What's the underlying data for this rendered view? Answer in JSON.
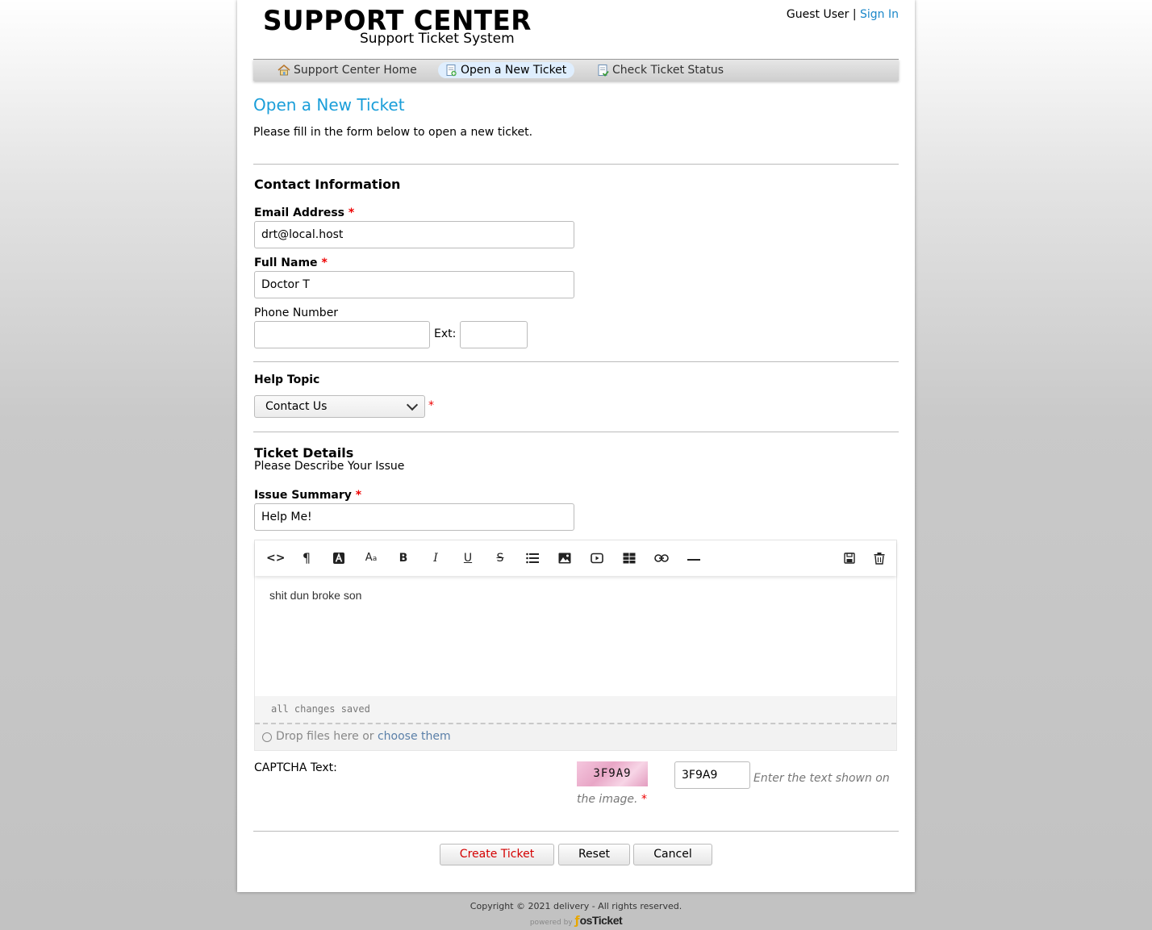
{
  "header": {
    "title": "SUPPORT CENTER",
    "subtitle": "Support Ticket System",
    "guest_label": "Guest User",
    "separator": "|",
    "sign_in": "Sign In"
  },
  "nav": {
    "items": [
      {
        "label": "Support Center Home",
        "icon": "home-icon"
      },
      {
        "label": "Open a New Ticket",
        "icon": "new-ticket-icon"
      },
      {
        "label": "Check Ticket Status",
        "icon": "ticket-status-icon"
      }
    ],
    "active": "Open a New Ticket"
  },
  "page": {
    "title": "Open a New Ticket",
    "intro": "Please fill in the form below to open a new ticket."
  },
  "contact": {
    "section_title": "Contact Information",
    "email_label": "Email Address",
    "email_value": "drt@local.host",
    "name_label": "Full Name",
    "name_value": "Doctor T",
    "phone_label": "Phone Number",
    "phone_value": "",
    "ext_label": "Ext:",
    "ext_value": ""
  },
  "help_topic": {
    "label": "Help Topic",
    "selected": "Contact Us"
  },
  "ticket": {
    "section_title": "Ticket Details",
    "section_sub": "Please Describe Your Issue",
    "summary_label": "Issue Summary",
    "summary_value": "Help Me!",
    "body_text": "shit dun broke son",
    "status_text": "all changes saved",
    "drop_text": "Drop files here or",
    "drop_link": "choose them"
  },
  "toolbar": {
    "items": [
      "html-icon",
      "paragraph-icon",
      "font-color-icon",
      "font-size-icon",
      "bold-icon",
      "italic-icon",
      "underline-icon",
      "strikethrough-icon",
      "list-icon",
      "image-icon",
      "video-icon",
      "table-icon",
      "link-icon",
      "horizontal-rule-icon"
    ],
    "right_items": [
      "save-draft-icon",
      "delete-draft-icon"
    ]
  },
  "captcha": {
    "label": "CAPTCHA Text:",
    "image_text": "3F9A9",
    "input_value": "3F9A9",
    "hint": "Enter the text shown on the image."
  },
  "buttons": {
    "create": "Create Ticket",
    "reset": "Reset",
    "cancel": "Cancel"
  },
  "footer": {
    "copyright": "Copyright © 2021 delivery - All rights reserved.",
    "powered_by": "powered by",
    "brand": "osTicket"
  },
  "colors": {
    "accent": "#1a9ed9",
    "link": "#1a87c9",
    "required": "#e00000",
    "primary_button_text": "#d40000"
  }
}
